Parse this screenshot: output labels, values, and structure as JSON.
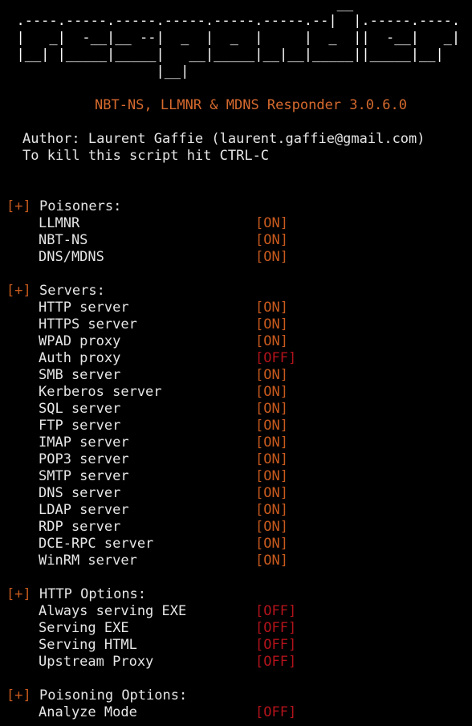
{
  "banner": [
    "                                         __",
    "  .----.-----.-----.-----.-----.-----.--|  |.-----.----.",
    "  |   _|  -__|__ --|  _  |  _  |     |  _  ||  -__|   _|",
    "  |__| |_____|_____|   __|_____|__|__|_____||_____|__|",
    "                   |__|"
  ],
  "title": "NBT-NS, LLMNR & MDNS Responder 3.0.6.0",
  "author": "Author: Laurent Gaffie (laurent.gaffie@gmail.com)",
  "kill_hint": "To kill this script hit CTRL-C",
  "marker": "[+]",
  "sections": [
    {
      "title": "Poisoners:",
      "items": [
        {
          "name": "LLMNR",
          "status": "[ON]"
        },
        {
          "name": "NBT-NS",
          "status": "[ON]"
        },
        {
          "name": "DNS/MDNS",
          "status": "[ON]"
        }
      ]
    },
    {
      "title": "Servers:",
      "items": [
        {
          "name": "HTTP server",
          "status": "[ON]"
        },
        {
          "name": "HTTPS server",
          "status": "[ON]"
        },
        {
          "name": "WPAD proxy",
          "status": "[ON]"
        },
        {
          "name": "Auth proxy",
          "status": "[OFF]"
        },
        {
          "name": "SMB server",
          "status": "[ON]"
        },
        {
          "name": "Kerberos server",
          "status": "[ON]"
        },
        {
          "name": "SQL server",
          "status": "[ON]"
        },
        {
          "name": "FTP server",
          "status": "[ON]"
        },
        {
          "name": "IMAP server",
          "status": "[ON]"
        },
        {
          "name": "POP3 server",
          "status": "[ON]"
        },
        {
          "name": "SMTP server",
          "status": "[ON]"
        },
        {
          "name": "DNS server",
          "status": "[ON]"
        },
        {
          "name": "LDAP server",
          "status": "[ON]"
        },
        {
          "name": "RDP server",
          "status": "[ON]"
        },
        {
          "name": "DCE-RPC server",
          "status": "[ON]"
        },
        {
          "name": "WinRM server",
          "status": "[ON]"
        }
      ]
    },
    {
      "title": "HTTP Options:",
      "items": [
        {
          "name": "Always serving EXE",
          "status": "[OFF]"
        },
        {
          "name": "Serving EXE",
          "status": "[OFF]"
        },
        {
          "name": "Serving HTML",
          "status": "[OFF]"
        },
        {
          "name": "Upstream Proxy",
          "status": "[OFF]"
        }
      ]
    },
    {
      "title": "Poisoning Options:",
      "items": [
        {
          "name": "Analyze Mode",
          "status": "[OFF]"
        }
      ]
    }
  ],
  "colors": {
    "background": "#000000",
    "text": "#e6e6e6",
    "accent_orange": "#c85a1e",
    "off_red": "#b3131b"
  }
}
